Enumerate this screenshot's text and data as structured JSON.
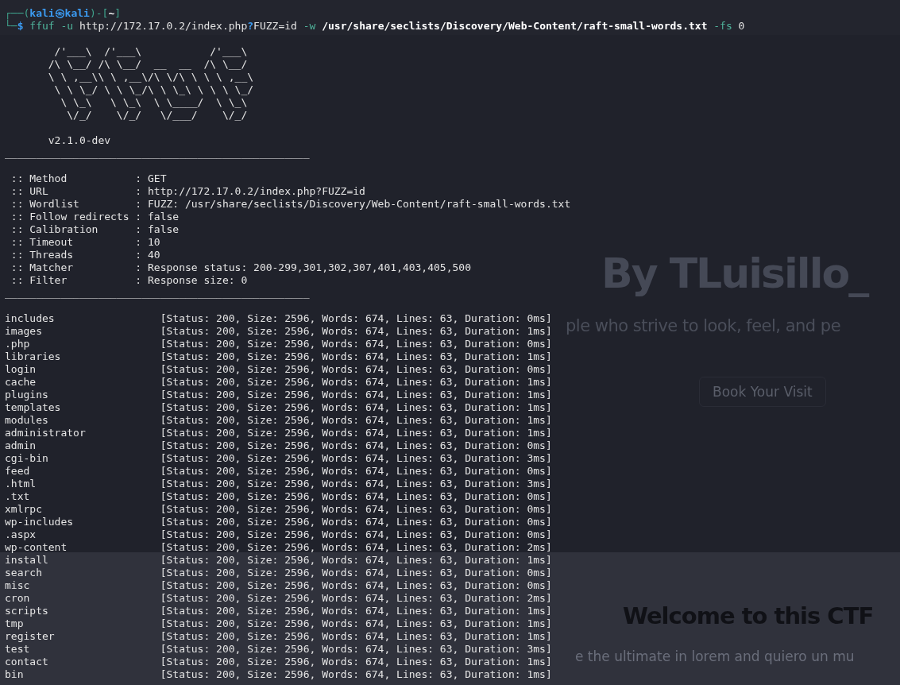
{
  "background_page": {
    "heading": "By TLuisillo_",
    "tagline": "ple who strive to look, feel, and pe",
    "button": "Book Your Visit",
    "section_heading": "Welcome to this CTF",
    "section_text": "e the ultimate in lorem and quiero un mu"
  },
  "terminal": {
    "prompt_line_1": [
      {
        "text": "┌──(",
        "kind": "frame"
      },
      {
        "text": "kali㉿kali",
        "kind": "user"
      },
      {
        "text": ")-[",
        "kind": "frame"
      },
      {
        "text": "~",
        "kind": "cwd"
      },
      {
        "text": "]",
        "kind": "frame"
      }
    ],
    "prompt_line_2": [
      {
        "text": "└─",
        "kind": "frame"
      },
      {
        "text": "$",
        "kind": "symbol"
      }
    ],
    "command_words": [
      [
        {
          "text": "ffuf",
          "kind": "command"
        }
      ],
      [
        {
          "text": "-u",
          "kind": "option"
        }
      ],
      [
        {
          "text": "http://172.17.0.2/index.php",
          "kind": "argument"
        },
        {
          "text": "?",
          "kind": "glob"
        },
        {
          "text": "FUZZ=id",
          "kind": "argument"
        }
      ],
      [
        {
          "text": "-w",
          "kind": "option"
        }
      ],
      [
        {
          "text": "/usr/share/seclists/Discovery/Web-Content/raft-small-words.txt",
          "kind": "path"
        }
      ],
      [
        {
          "text": "-fs",
          "kind": "option"
        }
      ],
      [
        {
          "text": "0",
          "kind": "argument"
        }
      ]
    ],
    "banner": [
      " /'___\\  /'___\\           /'___\\",
      "/\\ \\__/ /\\ \\__/  __  __  /\\ \\__/",
      "\\ \\ ,__\\\\ \\ ,__\\/\\ \\/\\ \\ \\ \\ ,__\\",
      " \\ \\ \\_/ \\ \\ \\_/\\ \\ \\_\\ \\ \\ \\ \\_/",
      "  \\ \\_\\   \\ \\_\\  \\ \\____/  \\ \\_\\",
      "   \\/_/    \\/_/   \\/___/    \\/_/"
    ],
    "version": "v2.1.0-dev",
    "separator_top": "_________________________________________________",
    "settings": [
      {
        "label": ":: Method",
        "value": ": GET"
      },
      {
        "label": ":: URL",
        "value": ": http://172.17.0.2/index.php?FUZZ=id"
      },
      {
        "label": ":: Wordlist",
        "value": ": FUZZ: /usr/share/seclists/Discovery/Web-Content/raft-small-words.txt"
      },
      {
        "label": ":: Follow redirects",
        "value": ": false"
      },
      {
        "label": ":: Calibration",
        "value": ": false"
      },
      {
        "label": ":: Timeout",
        "value": ": 10"
      },
      {
        "label": ":: Threads",
        "value": ": 40"
      },
      {
        "label": ":: Matcher",
        "value": ": Response status: 200-299,301,302,307,401,403,405,500"
      },
      {
        "label": ":: Filter",
        "value": ": Response size: 0"
      }
    ],
    "separator_bottom": "_________________________________________________",
    "results": [
      {
        "name": "includes",
        "result": "[Status: 200, Size: 2596, Words: 674, Lines: 63, Duration: 0ms]"
      },
      {
        "name": "images",
        "result": "[Status: 200, Size: 2596, Words: 674, Lines: 63, Duration: 1ms]"
      },
      {
        "name": ".php",
        "result": "[Status: 200, Size: 2596, Words: 674, Lines: 63, Duration: 0ms]"
      },
      {
        "name": "libraries",
        "result": "[Status: 200, Size: 2596, Words: 674, Lines: 63, Duration: 1ms]"
      },
      {
        "name": "login",
        "result": "[Status: 200, Size: 2596, Words: 674, Lines: 63, Duration: 0ms]"
      },
      {
        "name": "cache",
        "result": "[Status: 200, Size: 2596, Words: 674, Lines: 63, Duration: 1ms]"
      },
      {
        "name": "plugins",
        "result": "[Status: 200, Size: 2596, Words: 674, Lines: 63, Duration: 1ms]"
      },
      {
        "name": "templates",
        "result": "[Status: 200, Size: 2596, Words: 674, Lines: 63, Duration: 1ms]"
      },
      {
        "name": "modules",
        "result": "[Status: 200, Size: 2596, Words: 674, Lines: 63, Duration: 1ms]"
      },
      {
        "name": "administrator",
        "result": "[Status: 200, Size: 2596, Words: 674, Lines: 63, Duration: 1ms]"
      },
      {
        "name": "admin",
        "result": "[Status: 200, Size: 2596, Words: 674, Lines: 63, Duration: 0ms]"
      },
      {
        "name": "cgi-bin",
        "result": "[Status: 200, Size: 2596, Words: 674, Lines: 63, Duration: 3ms]"
      },
      {
        "name": "feed",
        "result": "[Status: 200, Size: 2596, Words: 674, Lines: 63, Duration: 0ms]"
      },
      {
        "name": ".html",
        "result": "[Status: 200, Size: 2596, Words: 674, Lines: 63, Duration: 3ms]"
      },
      {
        "name": ".txt",
        "result": "[Status: 200, Size: 2596, Words: 674, Lines: 63, Duration: 0ms]"
      },
      {
        "name": "xmlrpc",
        "result": "[Status: 200, Size: 2596, Words: 674, Lines: 63, Duration: 0ms]"
      },
      {
        "name": "wp-includes",
        "result": "[Status: 200, Size: 2596, Words: 674, Lines: 63, Duration: 0ms]"
      },
      {
        "name": ".aspx",
        "result": "[Status: 200, Size: 2596, Words: 674, Lines: 63, Duration: 0ms]"
      },
      {
        "name": "wp-content",
        "result": "[Status: 200, Size: 2596, Words: 674, Lines: 63, Duration: 2ms]"
      },
      {
        "name": "install",
        "result": "[Status: 200, Size: 2596, Words: 674, Lines: 63, Duration: 1ms]"
      },
      {
        "name": "search",
        "result": "[Status: 200, Size: 2596, Words: 674, Lines: 63, Duration: 0ms]"
      },
      {
        "name": "misc",
        "result": "[Status: 200, Size: 2596, Words: 674, Lines: 63, Duration: 0ms]"
      },
      {
        "name": "cron",
        "result": "[Status: 200, Size: 2596, Words: 674, Lines: 63, Duration: 2ms]"
      },
      {
        "name": "scripts",
        "result": "[Status: 200, Size: 2596, Words: 674, Lines: 63, Duration: 1ms]"
      },
      {
        "name": "tmp",
        "result": "[Status: 200, Size: 2596, Words: 674, Lines: 63, Duration: 1ms]"
      },
      {
        "name": "register",
        "result": "[Status: 200, Size: 2596, Words: 674, Lines: 63, Duration: 1ms]"
      },
      {
        "name": "test",
        "result": "[Status: 200, Size: 2596, Words: 674, Lines: 63, Duration: 3ms]"
      },
      {
        "name": "contact",
        "result": "[Status: 200, Size: 2596, Words: 674, Lines: 63, Duration: 1ms]"
      },
      {
        "name": "bin",
        "result": "[Status: 200, Size: 2596, Words: 674, Lines: 63, Duration: 1ms]"
      }
    ]
  }
}
